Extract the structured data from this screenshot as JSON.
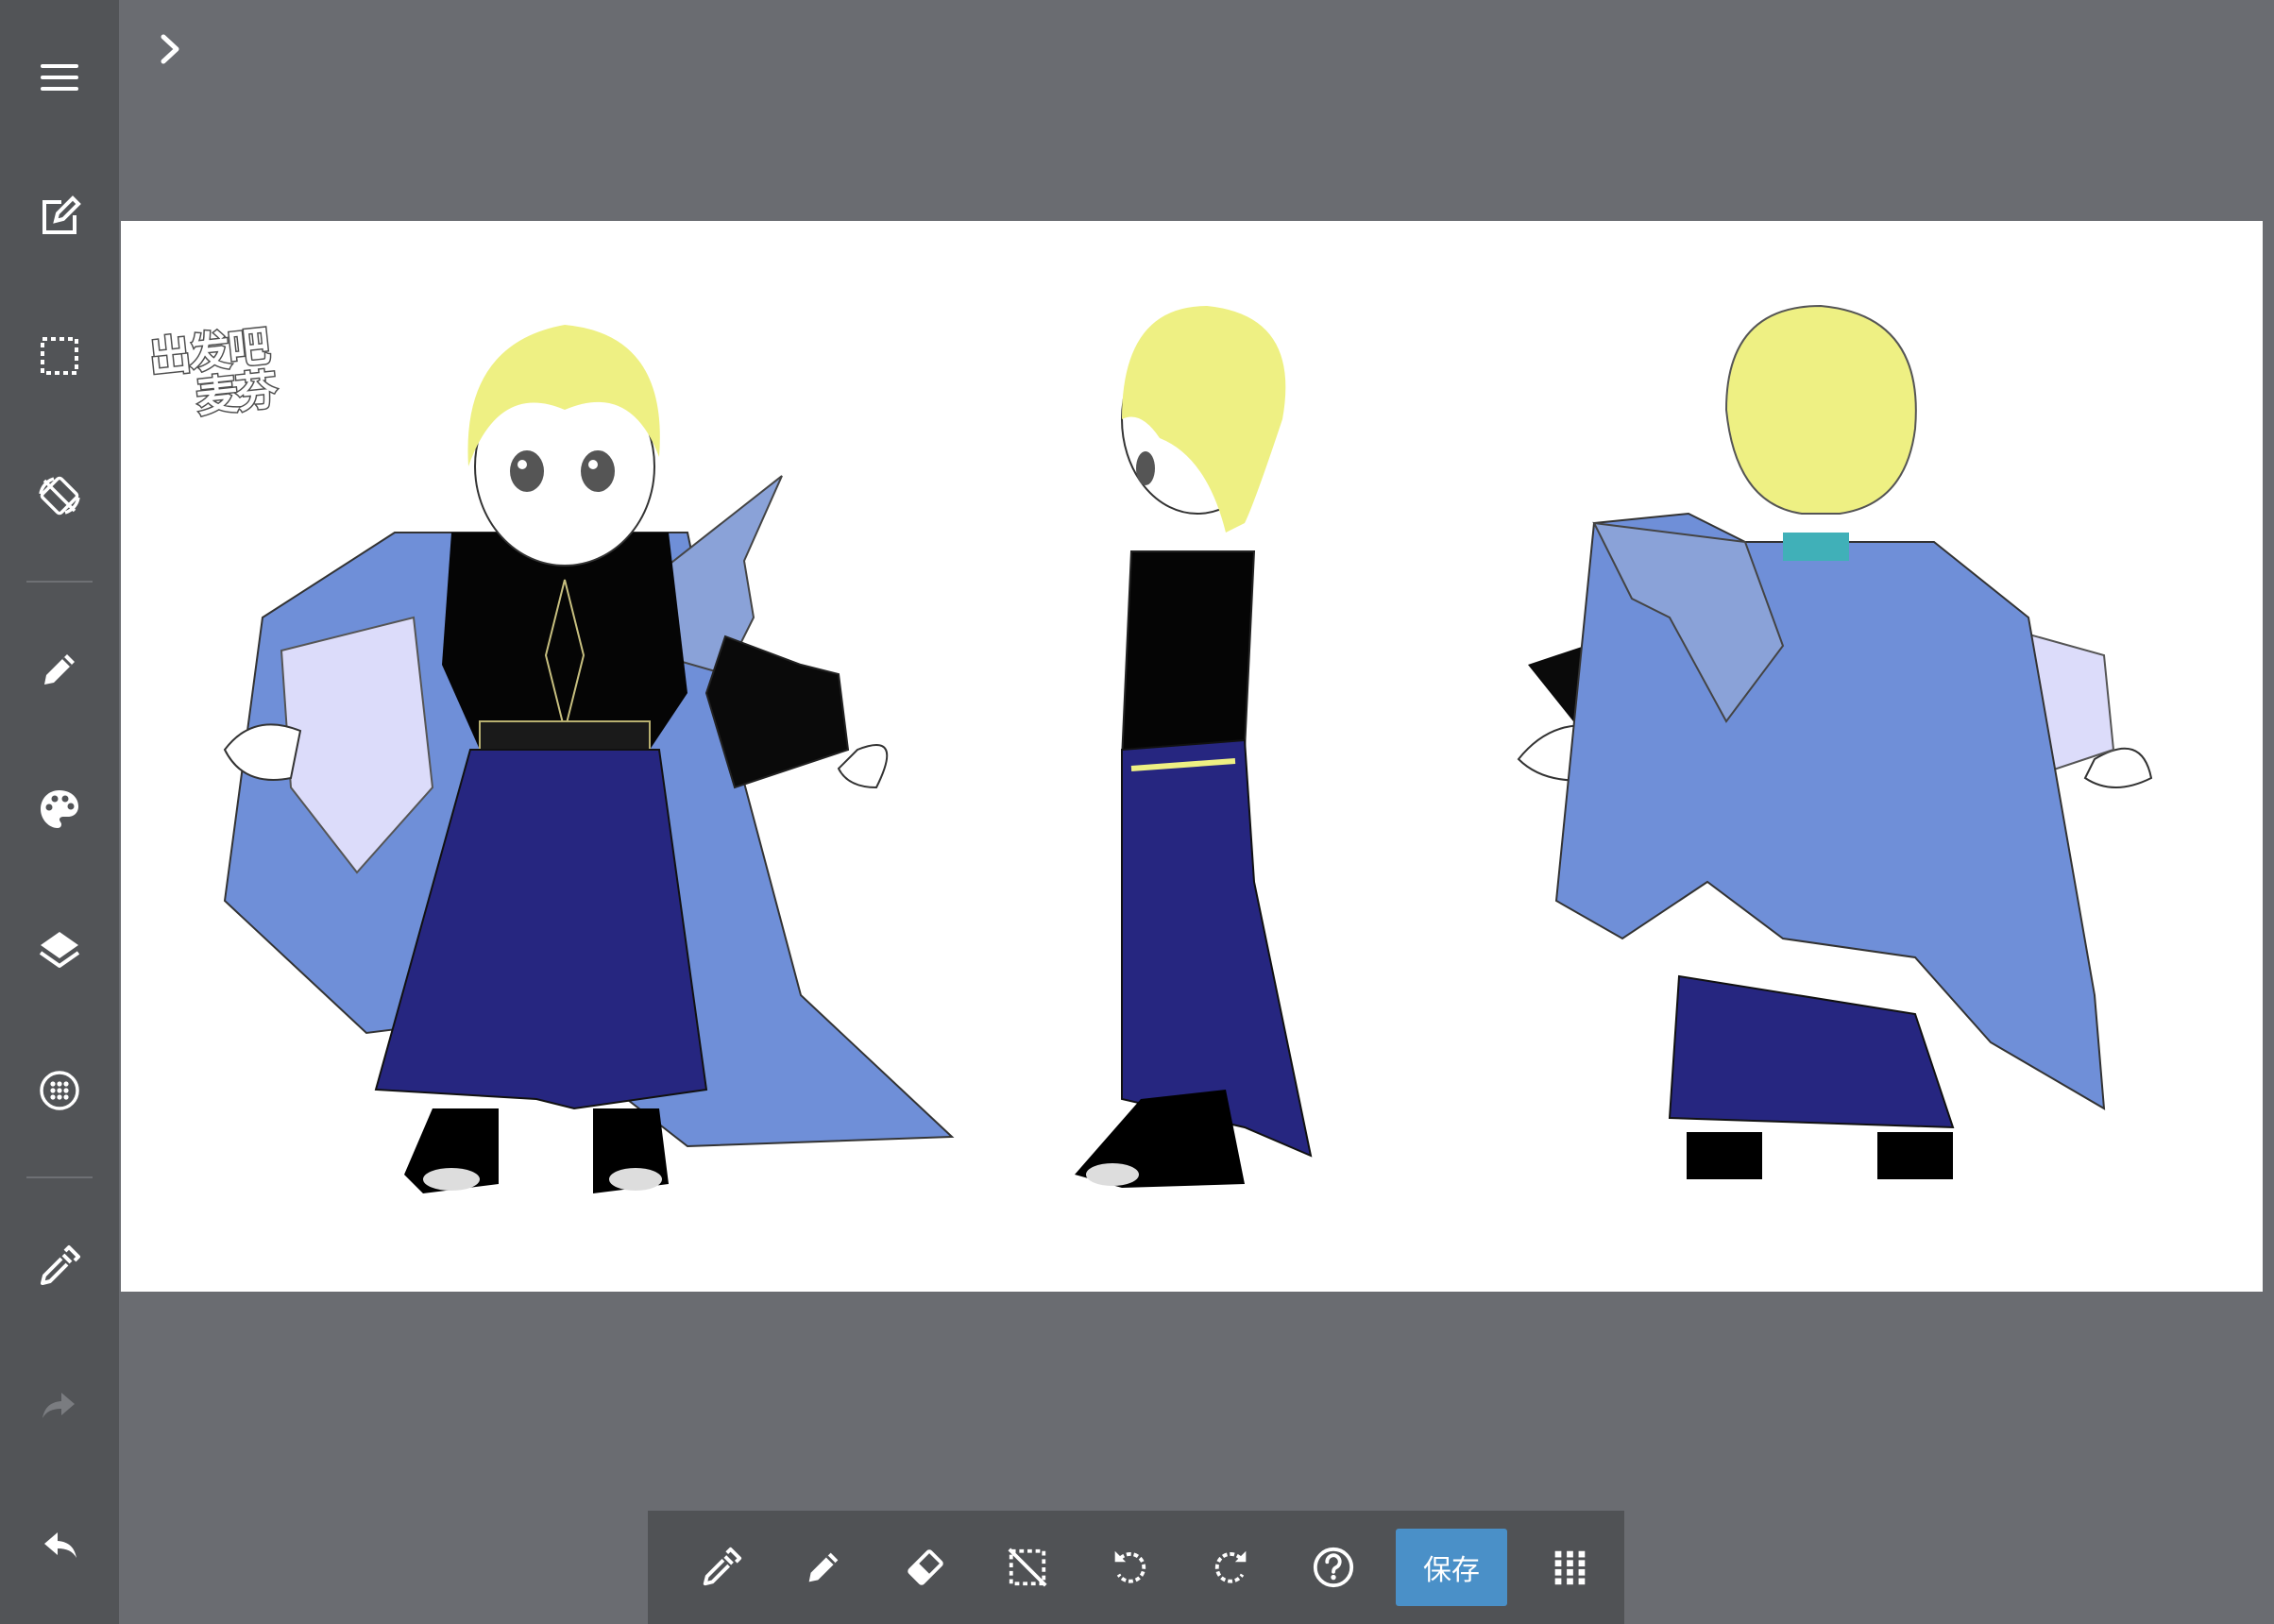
{
  "colors": {
    "sidebar_bg": "#525457",
    "workspace_bg": "#6a6c71",
    "canvas_bg": "#ffffff",
    "toolbar_bg": "#505255",
    "accent": "#4a90c8",
    "icon": "#ffffff",
    "icon_disabled": "#7a7c80"
  },
  "sidebar": {
    "items": [
      {
        "icon": "menu-icon"
      },
      {
        "icon": "edit-document-icon"
      },
      {
        "icon": "selection-icon"
      },
      {
        "icon": "rotate-canvas-icon"
      },
      {
        "icon": "pencil-icon"
      },
      {
        "icon": "palette-icon"
      },
      {
        "icon": "layers-icon"
      },
      {
        "icon": "grid-dots-icon"
      },
      {
        "icon": "eyedropper-icon"
      },
      {
        "icon": "redo-icon",
        "disabled": true
      },
      {
        "icon": "undo-icon"
      }
    ]
  },
  "canvas": {
    "logo_line1": "出发吧",
    "logo_line2": "麦芬"
  },
  "toolbar": {
    "items": [
      "eyedropper-icon",
      "pencil-icon",
      "eraser-icon",
      "deselect-icon",
      "rotate-left-icon",
      "rotate-right-icon",
      "help-icon"
    ],
    "save_label": "保存",
    "more_icon": "grid-menu-icon"
  }
}
